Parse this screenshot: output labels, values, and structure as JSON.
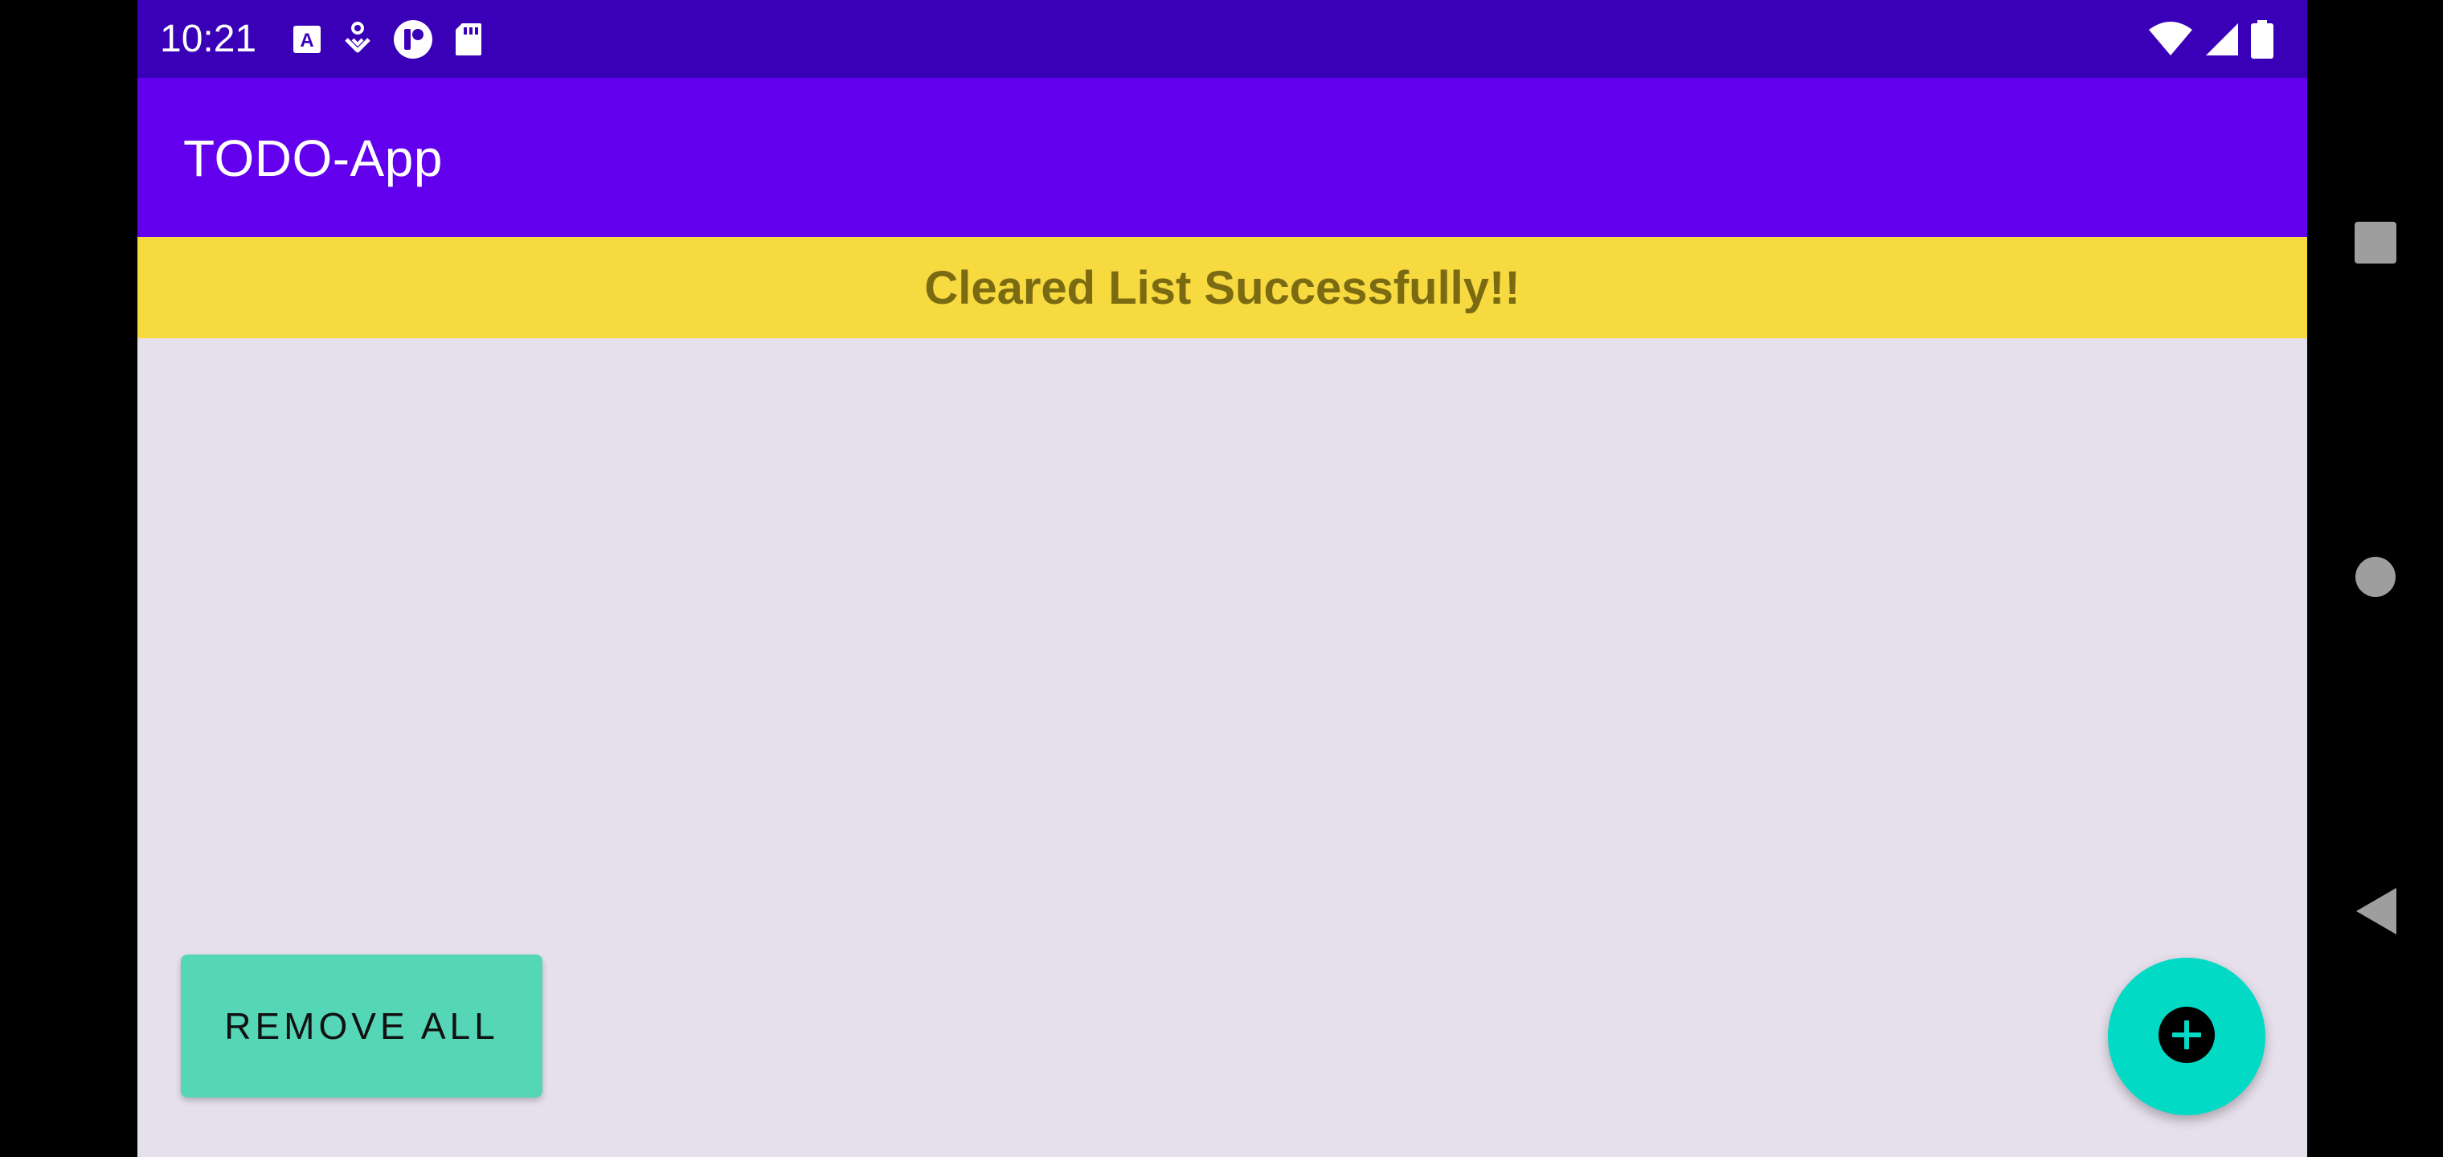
{
  "status_bar": {
    "time": "10:21",
    "left_icons": [
      "text-a-icon",
      "download-heart-icon",
      "circle-media-icon",
      "sd-card-icon"
    ],
    "right_icons": [
      "wifi-icon",
      "cell-signal-icon",
      "battery-icon"
    ]
  },
  "app_bar": {
    "title": "TODO-App"
  },
  "banner": {
    "message": "Cleared List Successfully!!"
  },
  "todo_list": {
    "items": []
  },
  "actions": {
    "remove_all_label": "REMOVE ALL",
    "fab_icon": "add-circle-icon"
  },
  "nav_bar": {
    "buttons": [
      "recents-square-icon",
      "home-circle-icon",
      "back-triangle-icon"
    ]
  },
  "colors": {
    "status_bar": "#3a00b8",
    "app_bar": "#6200ee",
    "banner_bg": "#f7d940",
    "banner_text": "#7a6a12",
    "content_bg": "#e6e0ec",
    "remove_all_button": "#55d6b6",
    "fab": "#03dac5"
  }
}
